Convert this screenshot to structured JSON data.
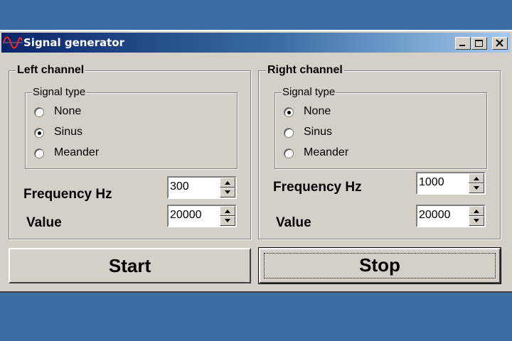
{
  "colors": {
    "desktop": "#3a6ea5",
    "window": "#d4d0c8"
  },
  "window": {
    "title": "Signal generator",
    "icon": "sine-wave-icon"
  },
  "titlebar_buttons": [
    "minimize-icon",
    "maximize-icon",
    "close-icon"
  ],
  "left": {
    "title": "Left channel",
    "signal_type_label": "Signal type",
    "options": [
      "None",
      "Sinus",
      "Meander"
    ],
    "selected": "Sinus",
    "frequency_label": "Frequency Hz",
    "frequency_value": "300",
    "value_label": "Value",
    "value_value": "20000"
  },
  "right": {
    "title": "Right channel",
    "signal_type_label": "Signal type",
    "options": [
      "None",
      "Sinus",
      "Meander"
    ],
    "selected": "None",
    "frequency_label": "Frequency Hz",
    "frequency_value": "1000",
    "value_label": "Value",
    "value_value": "20000"
  },
  "buttons": {
    "start": "Start",
    "stop": "Stop"
  }
}
